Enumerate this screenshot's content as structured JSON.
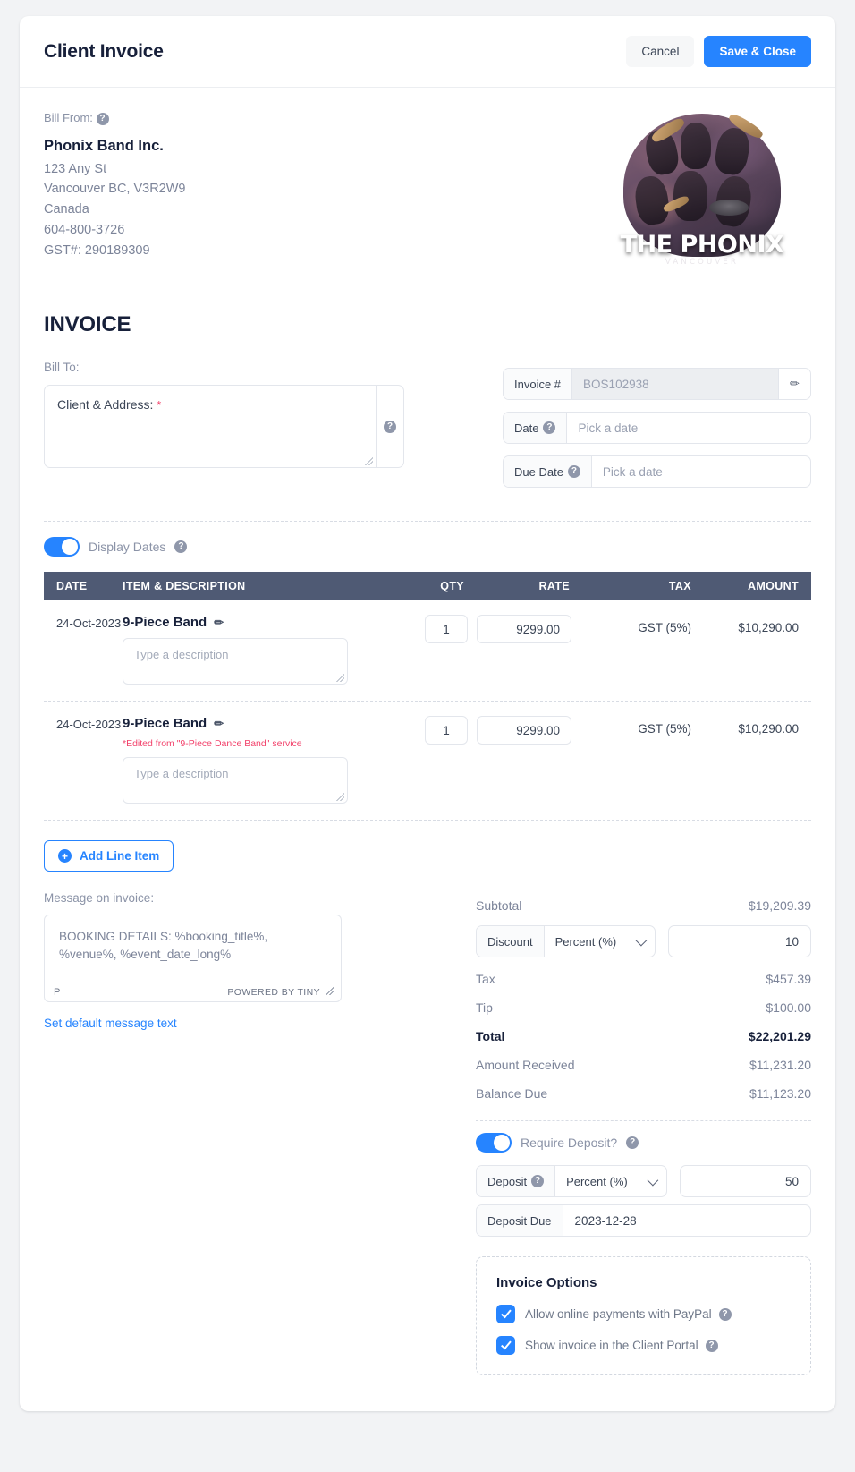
{
  "header": {
    "title": "Client Invoice",
    "cancel_label": "Cancel",
    "save_label": "Save & Close"
  },
  "bill_from": {
    "label": "Bill From:",
    "company": "Phonix Band Inc.",
    "address_line1": "123 Any St",
    "address_line2": "Vancouver BC, V3R2W9",
    "country": "Canada",
    "phone": "604-800-3726",
    "tax_id": "GST#: 290189309"
  },
  "logo": {
    "name": "THE PHONIX",
    "subtitle": "VANCOUVER"
  },
  "invoice": {
    "title": "INVOICE",
    "bill_to_label": "Bill To:",
    "client_address_label": "Client & Address:",
    "required_mark": "*",
    "number_label": "Invoice #",
    "number_value": "BOS102938",
    "date_label": "Date",
    "date_placeholder": "Pick a date",
    "due_date_label": "Due Date",
    "due_date_placeholder": "Pick a date"
  },
  "display_dates": {
    "label": "Display Dates",
    "on": true
  },
  "table": {
    "columns": [
      "DATE",
      "ITEM & DESCRIPTION",
      "QTY",
      "RATE",
      "TAX",
      "AMOUNT"
    ],
    "description_placeholder": "Type a description",
    "rows": [
      {
        "date": "24-Oct-2023",
        "item": "9-Piece Band",
        "edited_note": "",
        "qty": "1",
        "rate": "9299.00",
        "tax": "GST (5%)",
        "amount": "$10,290.00"
      },
      {
        "date": "24-Oct-2023",
        "item": "9-Piece Band",
        "edited_note": "*Edited from \"9-Piece Dance Band\" service",
        "qty": "1",
        "rate": "9299.00",
        "tax": "GST (5%)",
        "amount": "$10,290.00"
      }
    ]
  },
  "add_line_item_label": "Add Line Item",
  "message": {
    "label": "Message on invoice:",
    "content": "BOOKING DETAILS: %booking_title%, %venue%, %event_date_long%",
    "status_path": "P",
    "status_brand": "POWERED BY TINY",
    "set_default_link": "Set default message text"
  },
  "totals": {
    "subtotal_label": "Subtotal",
    "subtotal_value": "$19,209.39",
    "discount_label": "Discount",
    "discount_type": "Percent (%)",
    "discount_value": "10",
    "tax_label": "Tax",
    "tax_value": "$457.39",
    "tip_label": "Tip",
    "tip_value": "$100.00",
    "total_label": "Total",
    "total_value": "$22,201.29",
    "amount_received_label": "Amount Received",
    "amount_received_value": "$11,231.20",
    "balance_due_label": "Balance Due",
    "balance_due_value": "$11,123.20"
  },
  "deposit": {
    "require_label": "Require Deposit?",
    "require_on": true,
    "label": "Deposit",
    "type": "Percent (%)",
    "value": "50",
    "due_label": "Deposit Due",
    "due_value": "2023-12-28"
  },
  "options": {
    "title": "Invoice Options",
    "items": [
      {
        "label": "Allow online payments with PayPal",
        "checked": true
      },
      {
        "label": "Show invoice in the Client Portal",
        "checked": true
      }
    ]
  },
  "icons": {
    "help": "?",
    "pencil": "✏",
    "plus": "+"
  },
  "colors": {
    "accent": "#2684ff",
    "table_header": "#4f5a74",
    "required": "#f2426b",
    "text_dark": "#17203a",
    "text_muted": "#8b93a7"
  }
}
